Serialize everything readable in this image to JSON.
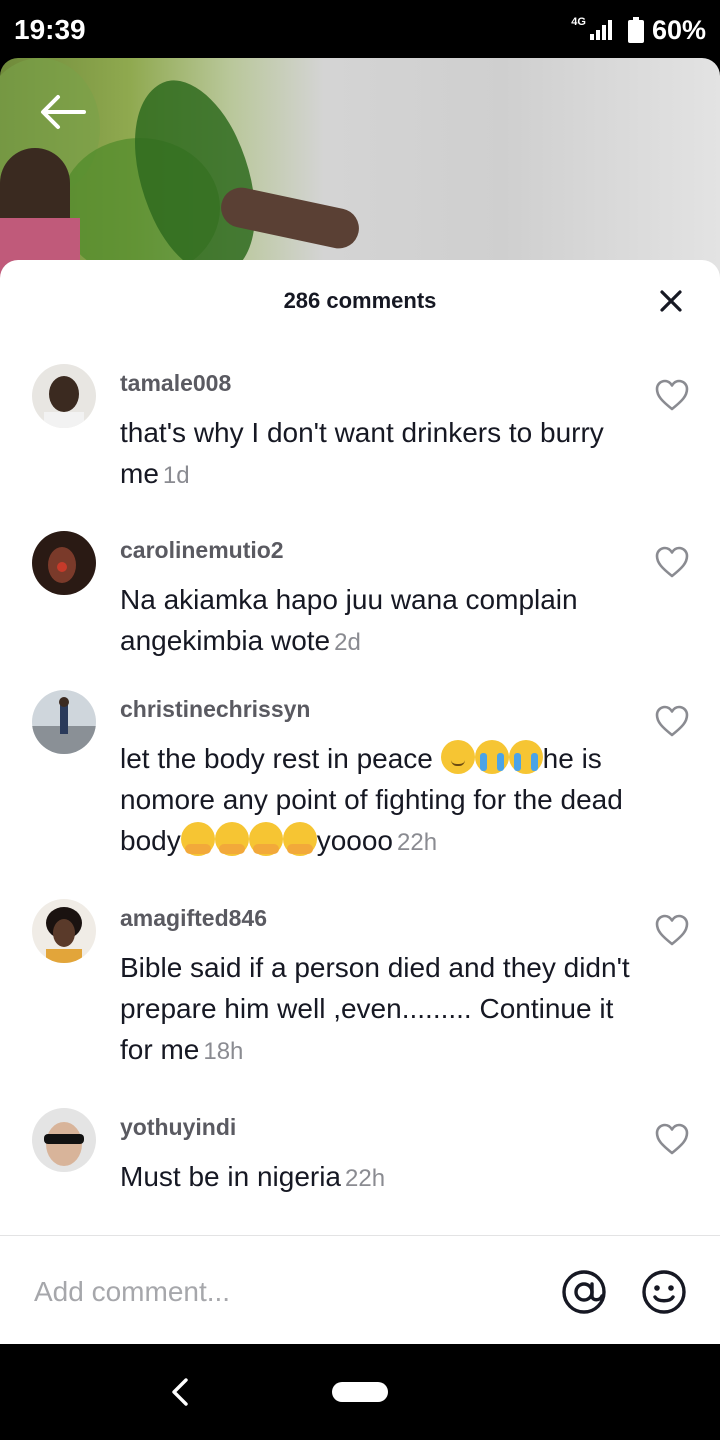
{
  "status_bar": {
    "time": "19:39",
    "network": "4G",
    "battery": "60%"
  },
  "header": {
    "comment_count": "286 comments"
  },
  "comments": [
    {
      "username": "tamale008",
      "text": "that's why I don't want drinkers to burry me",
      "time": "1d"
    },
    {
      "username": "carolinemutio2",
      "text": "Na akiamka hapo juu wana complain angekimbia wote",
      "time": "2d"
    },
    {
      "username": "christinechrissyn",
      "text_parts": [
        "let the body rest in peace ",
        "he is nomore any point of fighting for the dead body",
        "yoooo"
      ],
      "time": "22h"
    },
    {
      "username": "amagifted846",
      "text": "Bible said if a person died and they didn't prepare him well ,even......... Continue it for me",
      "time": "18h"
    },
    {
      "username": "yothuyindi",
      "text": "Must be in nigeria",
      "time": "22h"
    }
  ],
  "input": {
    "placeholder": "Add comment..."
  },
  "icons": {
    "back": "back-arrow-icon",
    "close": "close-icon",
    "like": "heart-outline-icon",
    "mention": "at-sign-icon",
    "emoji": "smiley-icon"
  },
  "colors": {
    "text_primary": "#161823",
    "text_secondary": "#8a8b91",
    "username": "#5a5a61"
  }
}
